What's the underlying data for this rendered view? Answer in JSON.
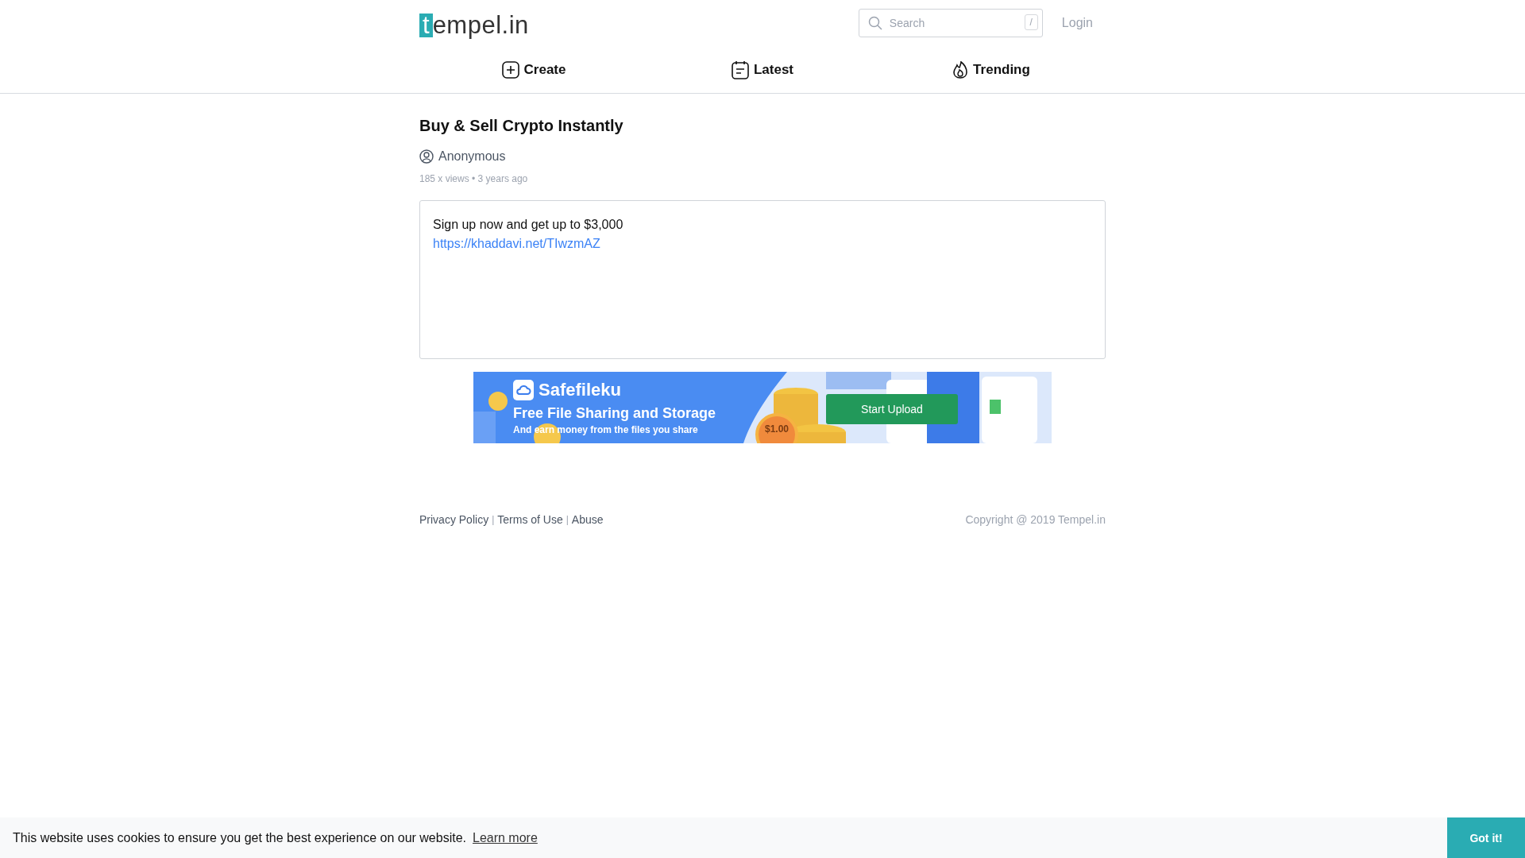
{
  "header": {
    "logo": {
      "mark": "t",
      "text": "empel.in"
    },
    "search": {
      "placeholder": "Search",
      "shortcut": "/"
    },
    "login": "Login"
  },
  "nav": [
    {
      "label": "Create",
      "kind": "create"
    },
    {
      "label": "Latest",
      "kind": "latest"
    },
    {
      "label": "Trending",
      "kind": "trending"
    }
  ],
  "paste": {
    "title": "Buy & Sell Crypto Instantly",
    "author": "Anonymous",
    "meta": "185 x views • 3 years ago",
    "lines": [
      {
        "kind": "text",
        "text": "Sign up now and get up to $3,000"
      },
      {
        "kind": "link",
        "text": "https://khaddavi.net/TIwzmAZ"
      }
    ]
  },
  "ad_banner": {
    "brand": "Safefileku",
    "headline": "Free File Sharing and Storage",
    "subline": "And earn money from the files you share",
    "coin": "$1.00",
    "button": "Start Upload"
  },
  "footer": {
    "links": [
      "Privacy Policy",
      "Terms of Use",
      "Abuse"
    ],
    "separator": "|",
    "copyright": "Copyright @ 2019 Tempel.in"
  },
  "cookie_bar": {
    "message": "This website uses cookies to ensure you get the best experience on our website.",
    "link": "Learn more",
    "button": "Got it!"
  }
}
